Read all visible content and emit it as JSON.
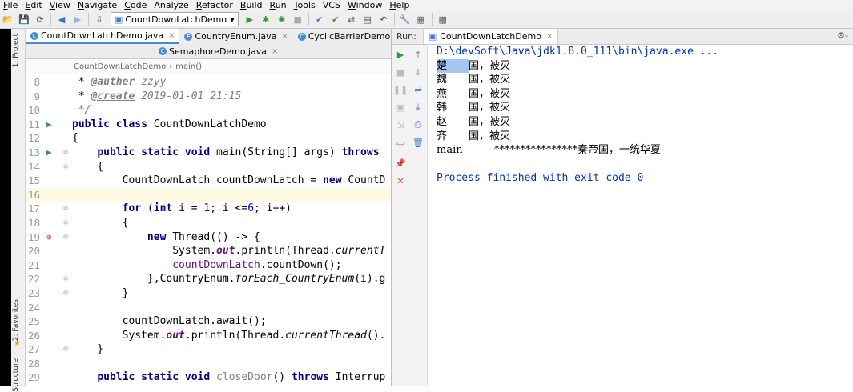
{
  "menu": [
    {
      "u": "F",
      "rest": "ile"
    },
    {
      "u": "E",
      "rest": "dit"
    },
    {
      "u": "V",
      "rest": "iew"
    },
    {
      "u": "N",
      "rest": "avigate"
    },
    {
      "u": "C",
      "rest": "ode"
    },
    {
      "u": "",
      "rest": "Analyze"
    },
    {
      "u": "R",
      "rest": "efactor"
    },
    {
      "u": "B",
      "rest": "uild"
    },
    {
      "u": "R",
      "rest": "un"
    },
    {
      "u": "T",
      "rest": "ools"
    },
    {
      "u": "",
      "rest": "VCS"
    },
    {
      "u": "W",
      "rest": "indow"
    },
    {
      "u": "H",
      "rest": "elp"
    }
  ],
  "toolbar": {
    "run_config": "CountDownLatchDemo"
  },
  "side": {
    "project": "1: Project",
    "favorites": "2: Favorites",
    "structure": "Structure"
  },
  "editor": {
    "tabs_row1": [
      {
        "label": "CountDownLatchDemo.java",
        "active": true
      },
      {
        "label": "CountryEnum.java",
        "active": false,
        "kind": "enum"
      },
      {
        "label": "CyclicBarrierDemo.java",
        "active": false
      }
    ],
    "tabs_row2": [
      {
        "label": "SemaphoreDemo.java",
        "active": false
      }
    ],
    "breadcrumb": [
      "CountDownLatchDemo",
      "main()"
    ]
  },
  "code_lines": [
    {
      "n": "8",
      "html": "&nbsp;* <span class='tag'>@auther</span><span class='cm'> zzyy</span>"
    },
    {
      "n": "9",
      "html": "&nbsp;* <span class='tag'>@create</span><span class='cm'> 2019-01-01 21:15</span>"
    },
    {
      "n": "10",
      "html": "<span class='cm'>&nbsp;*/</span>"
    },
    {
      "n": "11",
      "mark": "▶",
      "html": "<span class='kw'>public class</span> CountDownLatchDemo"
    },
    {
      "n": "12",
      "html": "{"
    },
    {
      "n": "13",
      "mark": "▶",
      "fold": "⊖",
      "html": "    <span class='kw'>public static void</span> main(String[] args) <span class='kw'>throws</span>"
    },
    {
      "n": "14",
      "fold": "⊖",
      "html": "    {"
    },
    {
      "n": "15",
      "html": "        CountDownLatch countDownLatch = <span class='kw'>new</span> CountD"
    },
    {
      "n": "16",
      "current": true,
      "html": ""
    },
    {
      "n": "17",
      "fold": "⊖",
      "html": "        <span class='kw'>for</span> (<span class='kw'>int</span> i = <span class='num'>1</span>; i &lt;=<span class='num'>6</span>; i++)"
    },
    {
      "n": "18",
      "fold": "⊖",
      "html": "        {"
    },
    {
      "n": "19",
      "mark": "⊛",
      "fold": "⊖",
      "html": "            <span class='kw'>new</span> Thread(() -&gt; {"
    },
    {
      "n": "20",
      "html": "                System.<span class='fld'>out</span>.println(Thread.<span class='ital'>currentT</span>"
    },
    {
      "n": "21",
      "html": "                <span class='fieldc'>countDownLatch</span>.countDown();"
    },
    {
      "n": "22",
      "fold": "⊖",
      "html": "            },CountryEnum.<span class='ital'>forEach_CountryEnum</span>(i).g"
    },
    {
      "n": "23",
      "fold": "⊖",
      "html": "        }"
    },
    {
      "n": "24",
      "html": ""
    },
    {
      "n": "25",
      "html": "        countDownLatch.await();"
    },
    {
      "n": "26",
      "html": "        System.<span class='fld'>out</span>.println(Thread.<span class='ital'>currentThread</span>()."
    },
    {
      "n": "27",
      "fold": "⊖",
      "html": "    }"
    },
    {
      "n": "28",
      "html": ""
    },
    {
      "n": "29",
      "html": "    <span class='kw'>public static void</span> <span class='grayn'>closeDoor</span>() <span class='kw'>throws</span> Interrup"
    }
  ],
  "run": {
    "label": "Run:",
    "tab": "CountDownLatchDemo"
  },
  "console_lines": [
    {
      "text": "D:\\devSoft\\Java\\jdk1.8.0_111\\bin\\java.exe ...",
      "style": "blue"
    },
    {
      "text": "楚\t国，被灭",
      "sel": 1
    },
    {
      "text": "魏\t国，被灭"
    },
    {
      "text": "燕\t国，被灭"
    },
    {
      "text": "韩\t国，被灭"
    },
    {
      "text": "赵\t国，被灭"
    },
    {
      "text": "齐\t国，被灭"
    },
    {
      "text": "main\t****************秦帝国，一统华夏"
    },
    {
      "text": ""
    },
    {
      "text": "Process finished with exit code 0",
      "style": "blue"
    }
  ]
}
